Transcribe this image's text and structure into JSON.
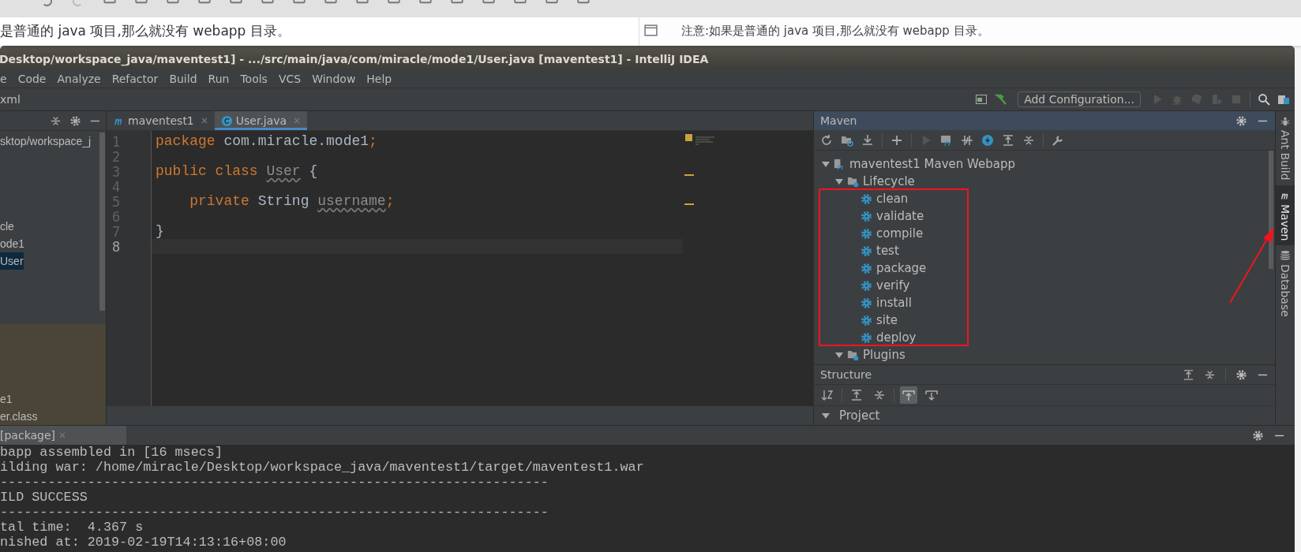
{
  "blog_text": {
    "left": "是普通的 java 项目,那么就没有 webapp 目录。",
    "right": "注意:如果是普通的 java 项目,那么就没有 webapp 目录。"
  },
  "window": {
    "title": "Desktop/workspace_java/maventest1] - .../src/main/java/com/miracle/mode1/User.java [maventest1] - IntelliJ IDEA"
  },
  "menu": [
    {
      "label": "e"
    },
    {
      "label": "Code"
    },
    {
      "label": "Analyze"
    },
    {
      "label": "Refactor"
    },
    {
      "label": "Build"
    },
    {
      "label": "Run"
    },
    {
      "label": "Tools"
    },
    {
      "label": "VCS"
    },
    {
      "label": "Window"
    },
    {
      "label": "Help"
    }
  ],
  "nav_bar": {
    "breadcrumb": "xml",
    "run_config": "Add Configuration..."
  },
  "project_panel": {
    "items": [
      {
        "label": "sktop/workspace_j",
        "selected": false
      },
      {
        "label": "cle",
        "selected": false
      },
      {
        "label": "ode1",
        "selected": false
      },
      {
        "label": "User",
        "selected": true
      }
    ],
    "excluded_items": [
      {
        "label": "e1"
      },
      {
        "label": "er.class"
      }
    ]
  },
  "editor": {
    "tabs": [
      {
        "label": "maventest1",
        "kind": "maven",
        "selected": false
      },
      {
        "label": "User.java",
        "kind": "class",
        "selected": true
      }
    ],
    "lines": [
      {
        "number": "1",
        "current": false,
        "tokens": [
          {
            "text": "package",
            "kind": "keyword"
          },
          {
            "text": " com.miracle.mode1",
            "kind": "plain"
          },
          {
            "text": ";",
            "kind": "keyword"
          }
        ]
      },
      {
        "number": "2",
        "current": false
      },
      {
        "number": "3",
        "current": false,
        "tokens": [
          {
            "text": "public class ",
            "kind": "keyword"
          },
          {
            "text": "User",
            "kind": "unused"
          },
          {
            "text": " {",
            "kind": "plain"
          }
        ]
      },
      {
        "number": "4",
        "current": false
      },
      {
        "number": "5",
        "current": false,
        "tokens": [
          {
            "text": "    private",
            "kind": "keyword"
          },
          {
            "text": " String ",
            "kind": "plain"
          },
          {
            "text": "username",
            "kind": "unused"
          },
          {
            "text": ";",
            "kind": "keyword"
          }
        ]
      },
      {
        "number": "6",
        "current": false
      },
      {
        "number": "7",
        "current": false,
        "tokens": [
          {
            "text": "}",
            "kind": "plain"
          }
        ]
      },
      {
        "number": "8",
        "current": true
      }
    ]
  },
  "maven_panel": {
    "title": "Maven",
    "tree": [
      {
        "label": "maventest1 Maven Webapp",
        "kind": "project",
        "expanded": true,
        "children": [
          {
            "label": "Lifecycle",
            "kind": "folder",
            "expanded": true,
            "children": [
              {
                "label": "clean",
                "kind": "goal"
              },
              {
                "label": "validate",
                "kind": "goal"
              },
              {
                "label": "compile",
                "kind": "goal"
              },
              {
                "label": "test",
                "kind": "goal"
              },
              {
                "label": "package",
                "kind": "goal"
              },
              {
                "label": "verify",
                "kind": "goal"
              },
              {
                "label": "install",
                "kind": "goal"
              },
              {
                "label": "site",
                "kind": "goal"
              },
              {
                "label": "deploy",
                "kind": "goal"
              }
            ]
          },
          {
            "label": "Plugins",
            "kind": "folder",
            "expanded": true
          }
        ]
      }
    ]
  },
  "structure_panel": {
    "title": "Structure",
    "toolbar": [
      {
        "kind": "sort",
        "on": false
      },
      {
        "kind": "expand",
        "on": false
      },
      {
        "kind": "collapse",
        "on": false
      },
      {
        "kind": "scroll-to",
        "on": true
      },
      {
        "kind": "scroll-from",
        "on": false
      }
    ],
    "root": {
      "label": "Project",
      "expanded": true
    }
  },
  "side_tabs": [
    {
      "label": "Ant Build",
      "kind": "ant",
      "selected": false
    },
    {
      "label": "Maven",
      "kind": "maven",
      "selected": true
    },
    {
      "label": "Database",
      "kind": "database",
      "selected": false
    }
  ],
  "run_panel": {
    "tab": "[package]",
    "lines": [
      "bapp assembled in [16 msecs]",
      "ilding war: /home/miracle/Desktop/workspace_java/maventest1/target/maventest1.war",
      "---------------------------------------------------------------------",
      "ILD SUCCESS",
      "---------------------------------------------------------------------",
      "tal time:  4.367 s",
      "nished at: 2019-02-19T14:13:16+08:00"
    ]
  }
}
